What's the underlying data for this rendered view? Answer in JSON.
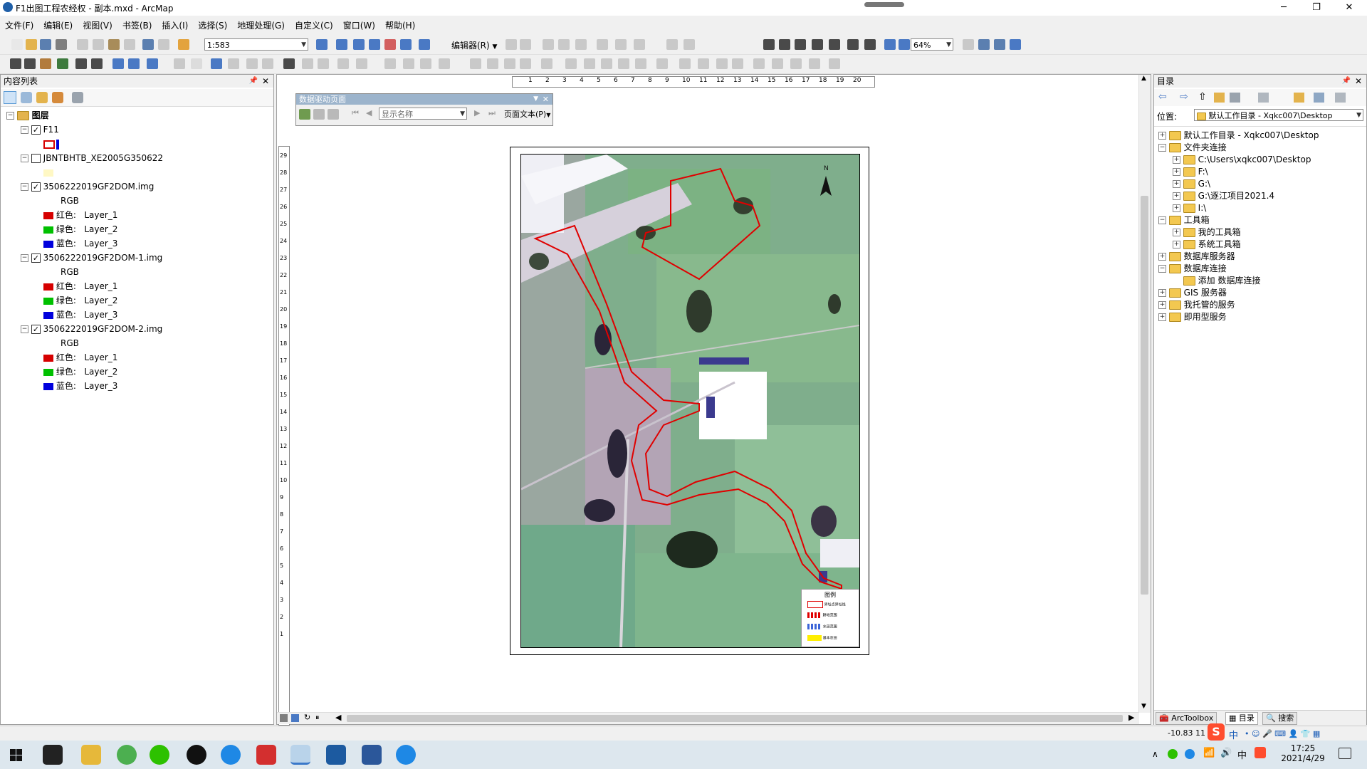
{
  "window": {
    "title": "F1出图工程农经权 - 副本.mxd - ArcMap",
    "minimize": "─",
    "maximize": "❐",
    "close": "✕"
  },
  "menu": [
    "文件(F)",
    "编辑(E)",
    "视图(V)",
    "书签(B)",
    "插入(I)",
    "选择(S)",
    "地理处理(G)",
    "自定义(C)",
    "窗口(W)",
    "帮助(H)"
  ],
  "toolbar": {
    "scale": "1:583",
    "editor_label": "编辑器(R)",
    "zoom": "64%"
  },
  "toc": {
    "title": "内容列表",
    "root": "图层",
    "layers": [
      {
        "name": "F11",
        "checked": true,
        "kind": "poly"
      },
      {
        "name": "JBNTBHTB_XE2005G350622",
        "checked": false,
        "kind": "fill"
      },
      {
        "name": "3506222019GF2DOM.img",
        "checked": true,
        "kind": "rgb",
        "rgb": "RGB",
        "bands": [
          {
            "label": "红色:",
            "band": "Layer_1"
          },
          {
            "label": "绿色:",
            "band": "Layer_2"
          },
          {
            "label": "蓝色:",
            "band": "Layer_3"
          }
        ]
      },
      {
        "name": "3506222019GF2DOM-1.img",
        "checked": true,
        "kind": "rgb",
        "rgb": "RGB",
        "bands": [
          {
            "label": "红色:",
            "band": "Layer_1"
          },
          {
            "label": "绿色:",
            "band": "Layer_2"
          },
          {
            "label": "蓝色:",
            "band": "Layer_3"
          }
        ]
      },
      {
        "name": "3506222019GF2DOM-2.img",
        "checked": true,
        "kind": "rgb",
        "rgb": "RGB",
        "bands": [
          {
            "label": "红色:",
            "band": "Layer_1"
          },
          {
            "label": "绿色:",
            "band": "Layer_2"
          },
          {
            "label": "蓝色:",
            "band": "Layer_3"
          }
        ]
      }
    ]
  },
  "ddp": {
    "title": "数据驱动页面",
    "name_field": "显示名称",
    "page_text": "页面文本(P)"
  },
  "ruler": {
    "top_labels": [
      "1",
      "2",
      "3",
      "4",
      "5",
      "6",
      "7",
      "8",
      "9",
      "10",
      "11",
      "12",
      "13",
      "14",
      "15",
      "16",
      "17",
      "18",
      "19",
      "20"
    ],
    "left_labels": [
      "29",
      "28",
      "27",
      "26",
      "25",
      "24",
      "23",
      "22",
      "21",
      "20",
      "19",
      "18",
      "17",
      "16",
      "15",
      "14",
      "13",
      "12",
      "11",
      "10",
      "9",
      "8",
      "7",
      "6",
      "5",
      "4",
      "3",
      "2",
      "1"
    ]
  },
  "legend": {
    "title": "图例",
    "items": [
      "界址点界址线",
      "耕地范围",
      "水田范围",
      "基本农田"
    ]
  },
  "catalog": {
    "title": "目录",
    "location_label": "位置:",
    "location_value": "默认工作目录 - Xqkc007\\Desktop",
    "items": [
      {
        "label": "默认工作目录 - Xqkc007\\Desktop",
        "level": 0,
        "exp": "+"
      },
      {
        "label": "文件夹连接",
        "level": 0,
        "exp": "−"
      },
      {
        "label": "C:\\Users\\xqkc007\\Desktop",
        "level": 1,
        "exp": "+"
      },
      {
        "label": "F:\\",
        "level": 1,
        "exp": "+"
      },
      {
        "label": "G:\\",
        "level": 1,
        "exp": "+"
      },
      {
        "label": "G:\\逐江项目2021.4",
        "level": 1,
        "exp": "+"
      },
      {
        "label": "I:\\",
        "level": 1,
        "exp": "+"
      },
      {
        "label": "工具箱",
        "level": 0,
        "exp": "−"
      },
      {
        "label": "我的工具箱",
        "level": 1,
        "exp": "+"
      },
      {
        "label": "系统工具箱",
        "level": 1,
        "exp": "+"
      },
      {
        "label": "数据库服务器",
        "level": 0,
        "exp": "+"
      },
      {
        "label": "数据库连接",
        "level": 0,
        "exp": "−"
      },
      {
        "label": "添加 数据库连接",
        "level": 1,
        "exp": ""
      },
      {
        "label": "GIS 服务器",
        "level": 0,
        "exp": "+"
      },
      {
        "label": "我托管的服务",
        "level": 0,
        "exp": "+"
      },
      {
        "label": "即用型服务",
        "level": 0,
        "exp": "+"
      }
    ],
    "tabs": [
      "ArcToolbox",
      "目录",
      "搜索"
    ]
  },
  "status": {
    "coords": "-10.83  11"
  },
  "taskbar": {
    "time": "17:25",
    "date": "2021/4/29",
    "ime": "中"
  },
  "colors": {
    "red": "#d60000",
    "green": "#00c000",
    "blue": "#0000dd",
    "parcel": "#e00000"
  }
}
